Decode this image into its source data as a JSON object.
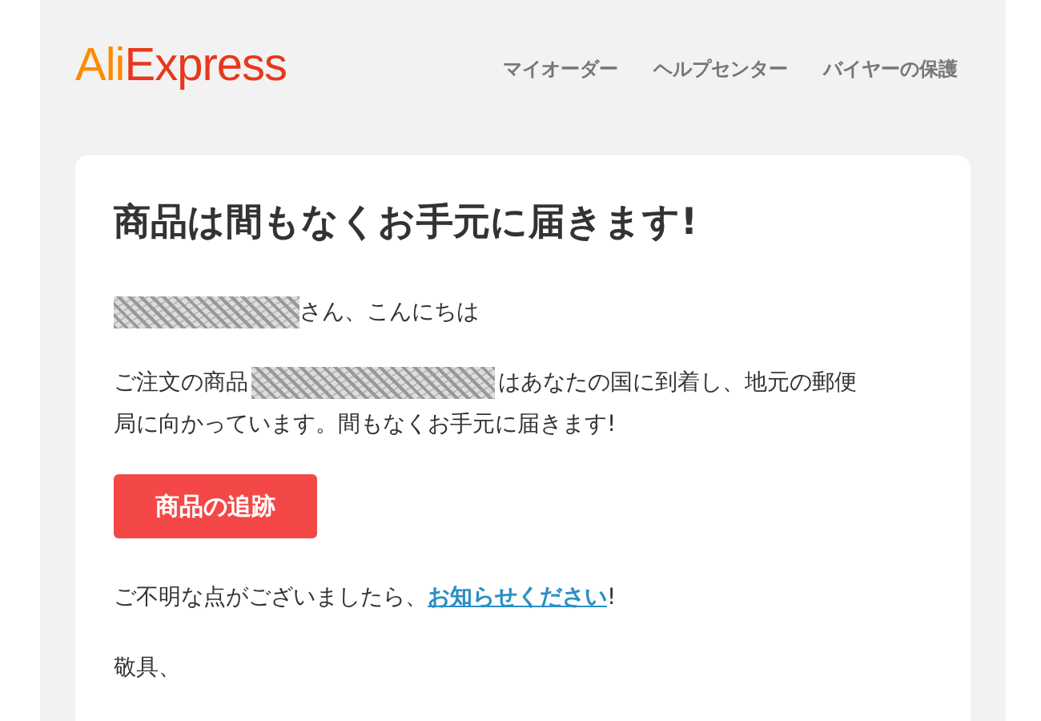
{
  "header": {
    "logo": {
      "part_1": "Ali",
      "part_2": "Express"
    },
    "nav": [
      "マイオーダー",
      "ヘルプセンター",
      "バイヤーの保護"
    ]
  },
  "card": {
    "title": "商品は間もなくお手元に届きます!",
    "greeting": {
      "redacted": true,
      "text": "さん、こんにちは"
    },
    "message": {
      "before": "ご注文の商品",
      "redacted": true,
      "after": "はあなたの国に到着し、地元の郵便",
      "continued": "局に向かっています。間もなくお手元に届きます!"
    },
    "button": "商品の追跡",
    "help": {
      "before": "ご不明な点がございましたら、",
      "link": "お知らせください",
      "after": "!"
    },
    "closing": "敬具、"
  }
}
